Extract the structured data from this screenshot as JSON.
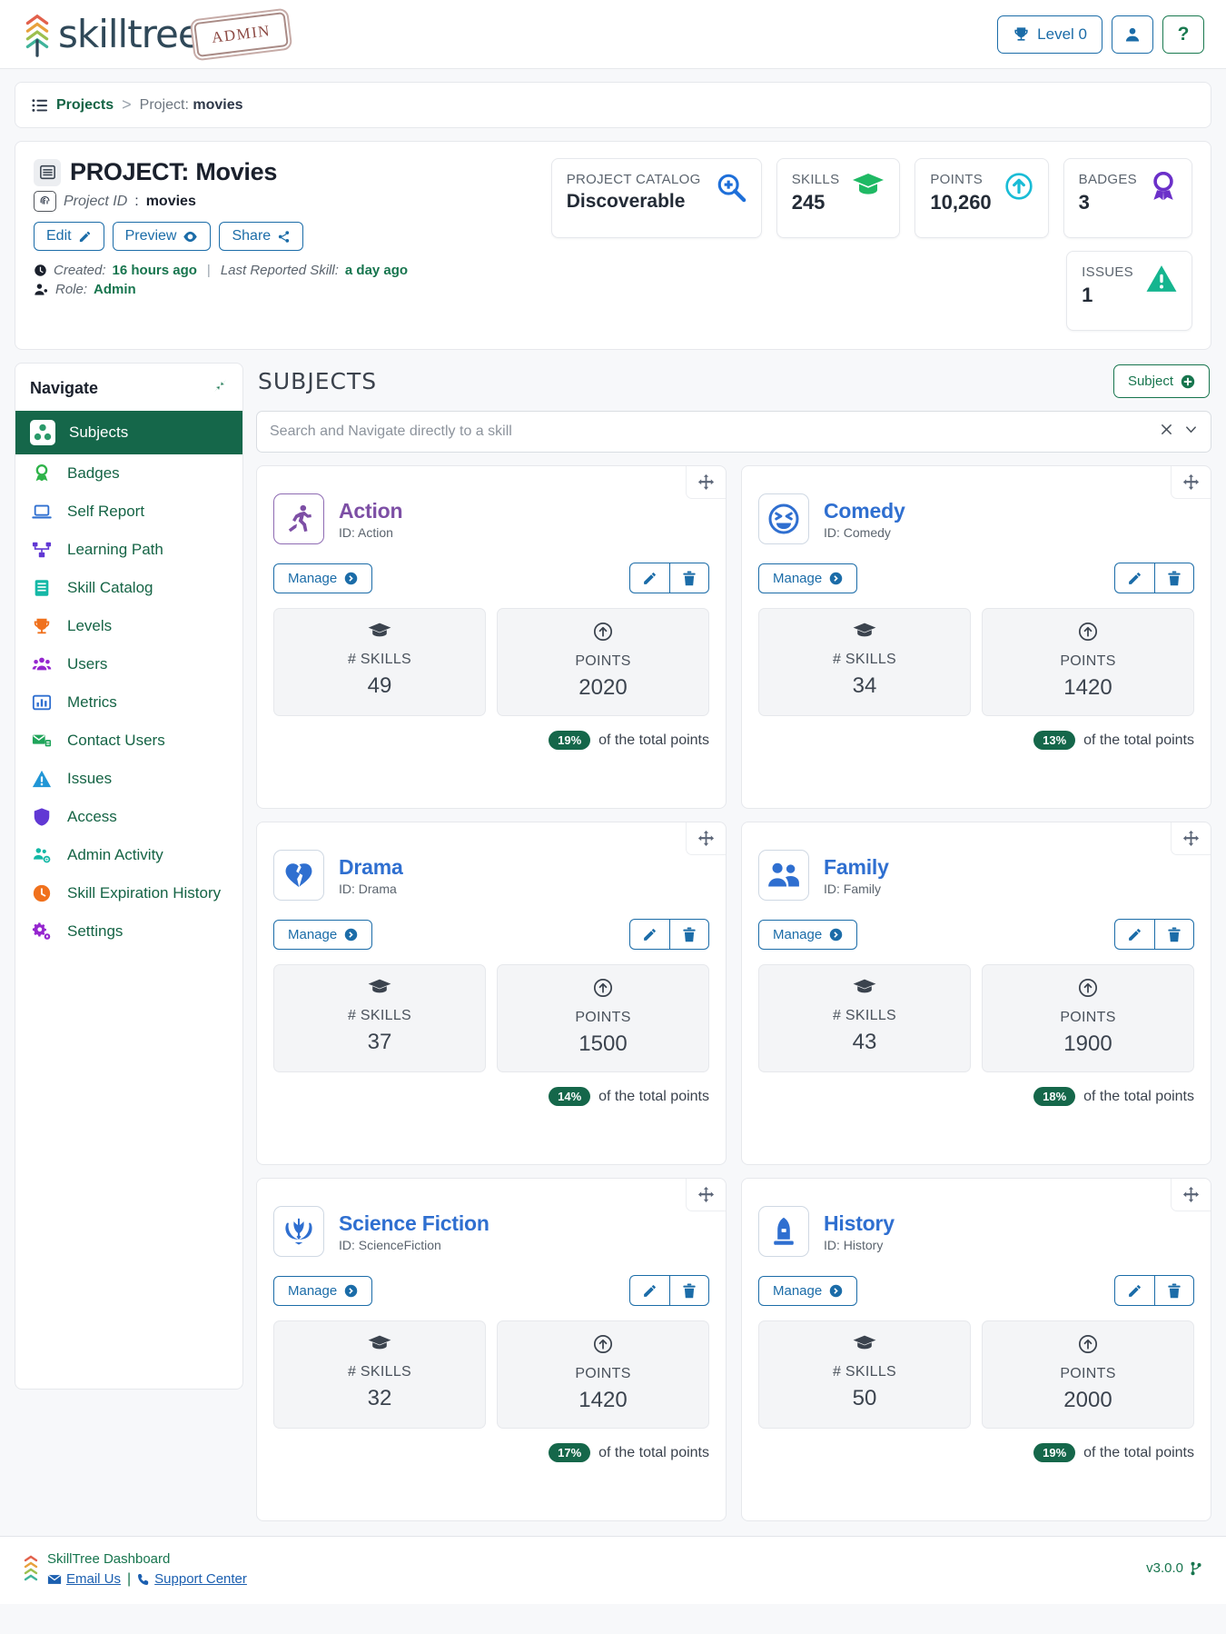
{
  "app": {
    "brand": "skilltree",
    "stamp": "ADMIN"
  },
  "topnav": {
    "level_label": "Level 0",
    "trophy_icon": "trophy-icon",
    "user_icon": "user-icon",
    "help_label": "?"
  },
  "breadcrumb": {
    "root": "Projects",
    "separator": ">",
    "current_prefix": "Project: ",
    "current_value": "movies"
  },
  "project": {
    "title": "PROJECT: Movies",
    "id_label": "Project ID",
    "id_value": "movies",
    "buttons": {
      "edit": "Edit",
      "preview": "Preview",
      "share": "Share"
    },
    "meta": {
      "created_label": "Created:",
      "created_value": "16 hours ago",
      "last_reported_label": "Last Reported Skill:",
      "last_reported_value": "a day ago",
      "role_label": "Role:",
      "role_value": "Admin"
    },
    "stats": [
      {
        "label": "PROJECT CATALOG",
        "value": "Discoverable",
        "icon": "search-plus-icon",
        "color": "#1e6fd9"
      },
      {
        "label": "SKILLS",
        "value": "245",
        "icon": "graduation-cap-icon",
        "color": "#1fb964"
      },
      {
        "label": "POINTS",
        "value": "10,260",
        "icon": "arrow-up-circle-icon",
        "color": "#19bcd6"
      },
      {
        "label": "BADGES",
        "value": "3",
        "icon": "award-ribbon-icon",
        "color": "#6b30c9"
      },
      {
        "label": "ISSUES",
        "value": "1",
        "icon": "warning-triangle-icon",
        "color": "#15b58f"
      }
    ]
  },
  "sidebar": {
    "title": "Navigate",
    "collapse_icon": "collapse-arrows-icon",
    "items": [
      {
        "label": "Subjects",
        "icon": "subjects-icon",
        "color": "#ffffff",
        "active": true
      },
      {
        "label": "Badges",
        "icon": "badge-icon",
        "color": "#2fb34a",
        "active": false
      },
      {
        "label": "Self Report",
        "icon": "laptop-icon",
        "color": "#2f6fd0",
        "active": false
      },
      {
        "label": "Learning Path",
        "icon": "network-icon",
        "color": "#6138d4",
        "active": false
      },
      {
        "label": "Skill Catalog",
        "icon": "book-icon",
        "color": "#14b8a6",
        "active": false
      },
      {
        "label": "Levels",
        "icon": "trophy-icon",
        "color": "#f0711d",
        "active": false
      },
      {
        "label": "Users",
        "icon": "users-icon",
        "color": "#9526cf",
        "active": false
      },
      {
        "label": "Metrics",
        "icon": "bar-chart-icon",
        "color": "#2f6fd0",
        "active": false
      },
      {
        "label": "Contact Users",
        "icon": "mail-users-icon",
        "color": "#1fa45a",
        "active": false
      },
      {
        "label": "Issues",
        "icon": "warning-triangle-icon",
        "color": "#2196d6",
        "active": false
      },
      {
        "label": "Access",
        "icon": "shield-icon",
        "color": "#6138d4",
        "active": false
      },
      {
        "label": "Admin Activity",
        "icon": "users-gear-icon",
        "color": "#14b8a6",
        "active": false
      },
      {
        "label": "Skill Expiration History",
        "icon": "clock-icon",
        "color": "#f0711d",
        "active": false
      },
      {
        "label": "Settings",
        "icon": "gears-icon",
        "color": "#9526cf",
        "active": false
      }
    ]
  },
  "main": {
    "heading": "SUBJECTS",
    "add_subject_label": "Subject",
    "search": {
      "placeholder": "Search and Navigate directly to a skill",
      "clear_icon": "close-icon",
      "chevron_icon": "chevron-down-icon"
    },
    "card_labels": {
      "manage": "Manage",
      "skills": "# SKILLS",
      "points": "POINTS",
      "of_total": "of the total points",
      "edit_icon": "edit-icon",
      "delete_icon": "trash-icon",
      "drag_icon": "drag-move-icon",
      "skills_icon": "graduation-cap-icon",
      "points_icon": "arrow-up-circle-icon"
    },
    "subjects": [
      {
        "name": "Action",
        "id_label": "ID: Action",
        "icon": "running-person-icon",
        "color": "#7d4fa5",
        "skills": "49",
        "points": "2020",
        "percent": "19%"
      },
      {
        "name": "Comedy",
        "id_label": "ID: Comedy",
        "icon": "laughing-face-icon",
        "color": "#2f6fd0",
        "skills": "34",
        "points": "1420",
        "percent": "13%"
      },
      {
        "name": "Drama",
        "id_label": "ID: Drama",
        "icon": "broken-heart-icon",
        "color": "#2f6fd0",
        "skills": "37",
        "points": "1500",
        "percent": "14%"
      },
      {
        "name": "Family",
        "id_label": "ID: Family",
        "icon": "family-people-icon",
        "color": "#2f6fd0",
        "skills": "43",
        "points": "1900",
        "percent": "18%"
      },
      {
        "name": "Science Fiction",
        "id_label": "ID: ScienceFiction",
        "icon": "jedi-order-icon",
        "color": "#2f6fd0",
        "skills": "32",
        "points": "1420",
        "percent": "17%"
      },
      {
        "name": "History",
        "id_label": "ID: History",
        "icon": "monument-icon",
        "color": "#2f6fd0",
        "skills": "50",
        "points": "2000",
        "percent": "19%"
      }
    ]
  },
  "footer": {
    "title": "SkillTree Dashboard",
    "email_label": "Email Us",
    "support_label": "Support Center",
    "version": "v3.0.0",
    "version_icon": "code-branch-icon"
  }
}
